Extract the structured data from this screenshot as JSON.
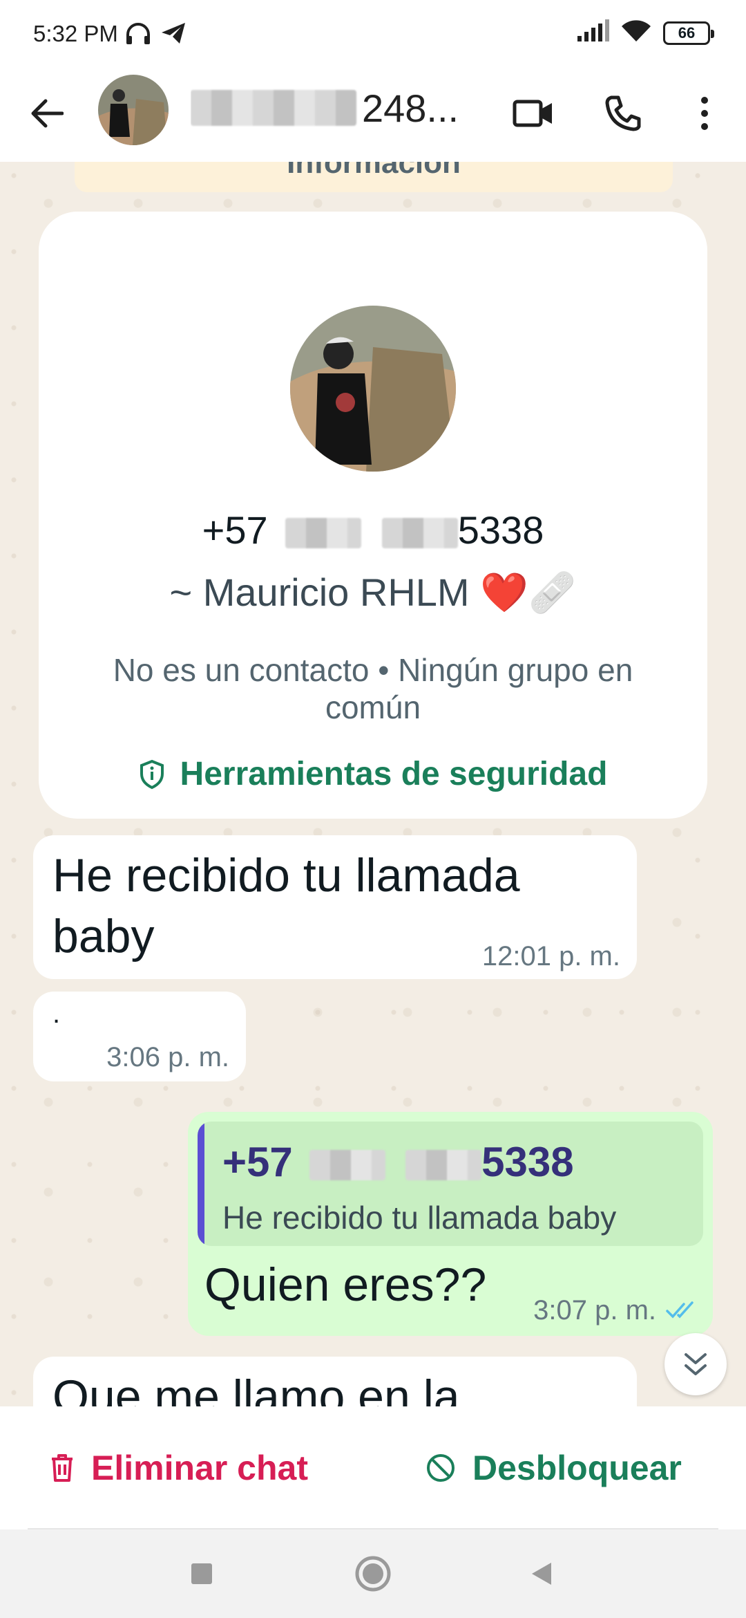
{
  "status_bar": {
    "time": "5:32 PM",
    "battery": "66",
    "icons": [
      "headphones-icon",
      "telegram-icon",
      "signal-icon",
      "wifi-icon",
      "battery-icon"
    ]
  },
  "header": {
    "contact_name_visible": "248...",
    "actions": [
      "video-call-icon",
      "voice-call-icon",
      "more-icon"
    ]
  },
  "banner": {
    "text": "Información"
  },
  "info_card": {
    "phone_prefix": "+57",
    "phone_suffix": "5338",
    "display_name": "~ Mauricio RHLM ❤️🩹",
    "subtitle": "No es un contacto • Ningún grupo en común",
    "security_link": "Herramientas de seguridad"
  },
  "messages": [
    {
      "direction": "in",
      "text": "He recibido tu llamada baby",
      "time": "12:01 p. m."
    },
    {
      "direction": "in",
      "text": ".",
      "time": "3:06 p. m."
    },
    {
      "direction": "out",
      "quote": {
        "author_prefix": "+57",
        "author_suffix": "5338",
        "text": "He recibido tu llamada baby"
      },
      "text": "Quien eres??",
      "time": "3:07 p. m.",
      "status": "read"
    },
    {
      "direction": "in",
      "text": "Que me llamo en la"
    }
  ],
  "actions": {
    "delete_chat": "Eliminar chat",
    "unblock": "Desbloquear"
  },
  "colors": {
    "accent_green": "#1a7f5a",
    "danger_red": "#d71e55",
    "outgoing_bubble": "#d9fdd3",
    "chat_background": "#f3ede4",
    "read_ticks": "#53bdeb"
  }
}
